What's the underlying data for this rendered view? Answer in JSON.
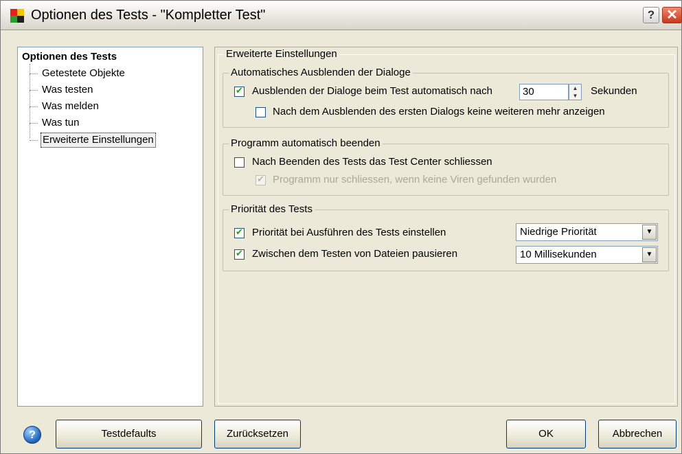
{
  "window": {
    "title": "Optionen des Tests - \"Kompletter Test\"",
    "help_button": "?",
    "close_button": "✕",
    "icon_colors": [
      "#e3221a",
      "#f4c400",
      "#2c9c2c",
      "#1f1f1f"
    ]
  },
  "tree": {
    "root": "Optionen des Tests",
    "items": [
      {
        "label": "Getestete Objekte",
        "selected": false
      },
      {
        "label": "Was testen",
        "selected": false
      },
      {
        "label": "Was melden",
        "selected": false
      },
      {
        "label": "Was tun",
        "selected": false
      },
      {
        "label": "Erweiterte Einstellungen",
        "selected": true
      }
    ]
  },
  "panel": {
    "title": "Erweiterte Einstellungen",
    "group_autohide": {
      "title": "Automatisches Ausblenden der Dialoge",
      "hide_auto_label": "Ausblenden der Dialoge beim Test automatisch nach",
      "hide_auto_checked": true,
      "seconds_value": "30",
      "seconds_unit": "Sekunden",
      "no_more_label": "Nach dem Ausblenden des ersten Dialogs keine weiteren mehr anzeigen",
      "no_more_checked": false
    },
    "group_exit": {
      "title": "Programm automatisch beenden",
      "close_center_label": "Nach Beenden des Tests das Test Center schliessen",
      "close_center_checked": false,
      "only_if_clean_label": "Programm nur schliessen, wenn keine Viren gefunden wurden",
      "only_if_clean_checked": true,
      "only_if_clean_disabled": true
    },
    "group_priority": {
      "title": "Priorität des Tests",
      "set_priority_label": "Priorität bei Ausführen des Tests einstellen",
      "set_priority_checked": true,
      "priority_value": "Niedrige Priorität",
      "pause_label": "Zwischen dem Testen von Dateien pausieren",
      "pause_checked": true,
      "pause_value": "10 Millisekunden"
    }
  },
  "buttons": {
    "help": "?",
    "defaults": "Testdefaults",
    "reset": "Zurücksetzen",
    "ok": "OK",
    "cancel": "Abbrechen"
  }
}
